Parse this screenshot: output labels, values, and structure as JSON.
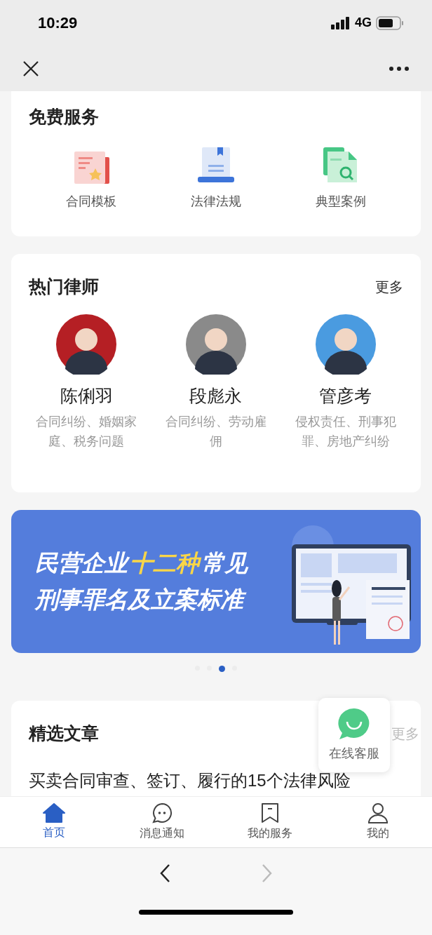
{
  "status_bar": {
    "time": "10:29",
    "network": "4G"
  },
  "free_services": {
    "title": "免费服务",
    "items": [
      {
        "kind": "contract",
        "label": "合同模板"
      },
      {
        "kind": "law",
        "label": "法律法规"
      },
      {
        "kind": "case",
        "label": "典型案例"
      }
    ]
  },
  "hot_lawyers": {
    "title": "热门律师",
    "more": "更多",
    "lawyers": [
      {
        "name": "陈俐羽",
        "specialty": "合同纠纷、婚姻家庭、税务问题",
        "color": "#b51f24"
      },
      {
        "name": "段彪永",
        "specialty": "合同纠纷、劳动雇佣",
        "color": "#8a8a8a"
      },
      {
        "name": "管彦考",
        "specialty": "侵权责任、刑事犯罪、房地产纠纷",
        "color": "#4a9be0"
      }
    ]
  },
  "banner": {
    "lines": [
      [
        {
          "text": "民营企业",
          "highlight": false
        },
        {
          "text": "十二种",
          "highlight": true
        },
        {
          "text": "常见",
          "highlight": false
        }
      ],
      [
        {
          "text": "刑事罪名及立案标准",
          "highlight": false
        }
      ]
    ]
  },
  "carousel_dots": [
    {
      "selected": false
    },
    {
      "selected": false
    },
    {
      "selected": true
    },
    {
      "selected": false
    }
  ],
  "featured_articles": {
    "title": "精选文章",
    "more": "更多",
    "articles": [
      "买卖合同审查、签订、履行的15个法律风险"
    ]
  },
  "floating_service": {
    "label": "在线客服"
  },
  "tab_bar": [
    {
      "kind": "home",
      "label": "首页",
      "selected": true
    },
    {
      "kind": "message",
      "label": "消息通知",
      "selected": false
    },
    {
      "kind": "service",
      "label": "我的服务",
      "selected": false
    },
    {
      "kind": "me",
      "label": "我的",
      "selected": false
    }
  ]
}
